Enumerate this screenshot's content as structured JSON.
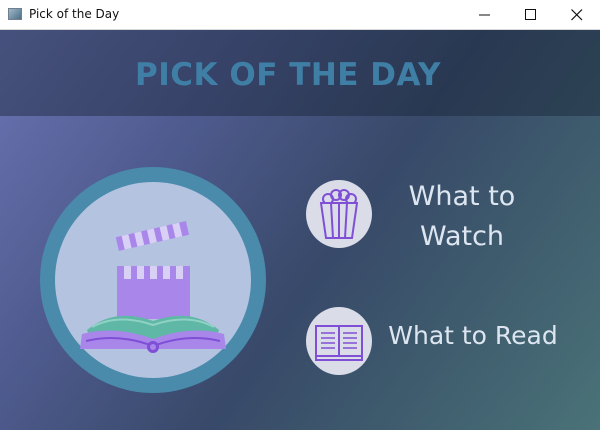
{
  "window": {
    "title": "Pick of the Day",
    "icons": {
      "app": "app-window-icon",
      "minimize": "minimize-icon",
      "maximize": "maximize-icon",
      "close": "close-icon"
    }
  },
  "header": {
    "title": "PICK OF THE DAY"
  },
  "hero": {
    "icon": "clapperboard-and-open-book-icon"
  },
  "options": {
    "watch": {
      "icon": "popcorn-icon",
      "label_line1": "What to",
      "label_line2": "Watch"
    },
    "read": {
      "icon": "book-icon",
      "label": "What to Read"
    }
  },
  "colors": {
    "title_text": "#3f7fa6",
    "header_band": "#1b2a40",
    "ring": "#4a8aab",
    "disc": "#b3c3e0",
    "icon_purple": "#7f4fd6",
    "icon_teal": "#5fb7a6",
    "label_text": "#dde6f0"
  }
}
